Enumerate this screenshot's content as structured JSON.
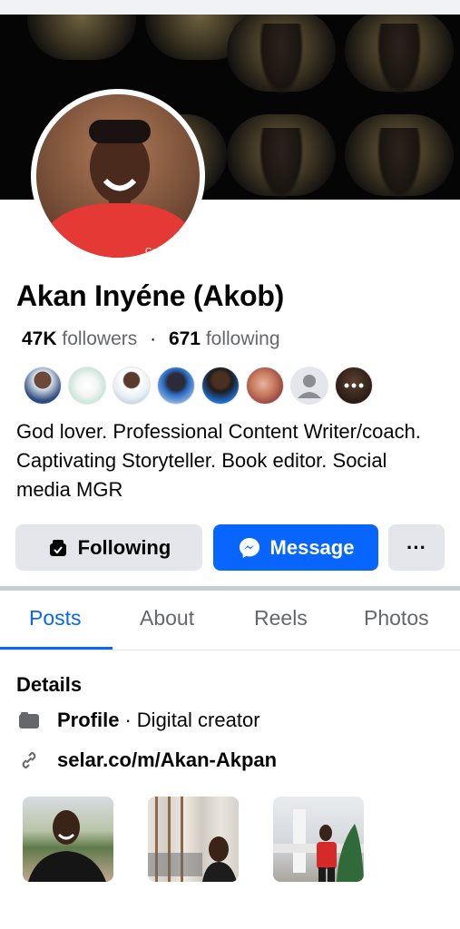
{
  "profile": {
    "name": "Akan Inyéne (Akob)",
    "followers_count": "47K",
    "followers_label": "followers",
    "separator": "·",
    "following_count": "671",
    "following_label": "following",
    "bio": "God lover. Professional Content Writer/coach. Captivating Storyteller. Book editor. Social media MGR"
  },
  "actions": {
    "following_label": "Following",
    "message_label": "Message",
    "more_label": "···"
  },
  "tabs": [
    {
      "label": "Posts"
    },
    {
      "label": "About"
    },
    {
      "label": "Reels"
    },
    {
      "label": "Photos"
    }
  ],
  "details": {
    "title": "Details",
    "profile_label": "Profile",
    "profile_separator": "·",
    "profile_value": "Digital creator",
    "link": "selar.co/m/Akan-Akpan"
  },
  "colors": {
    "accent": "#0866ff",
    "secondary_button": "#e4e6eb",
    "muted_text": "#65676b"
  }
}
